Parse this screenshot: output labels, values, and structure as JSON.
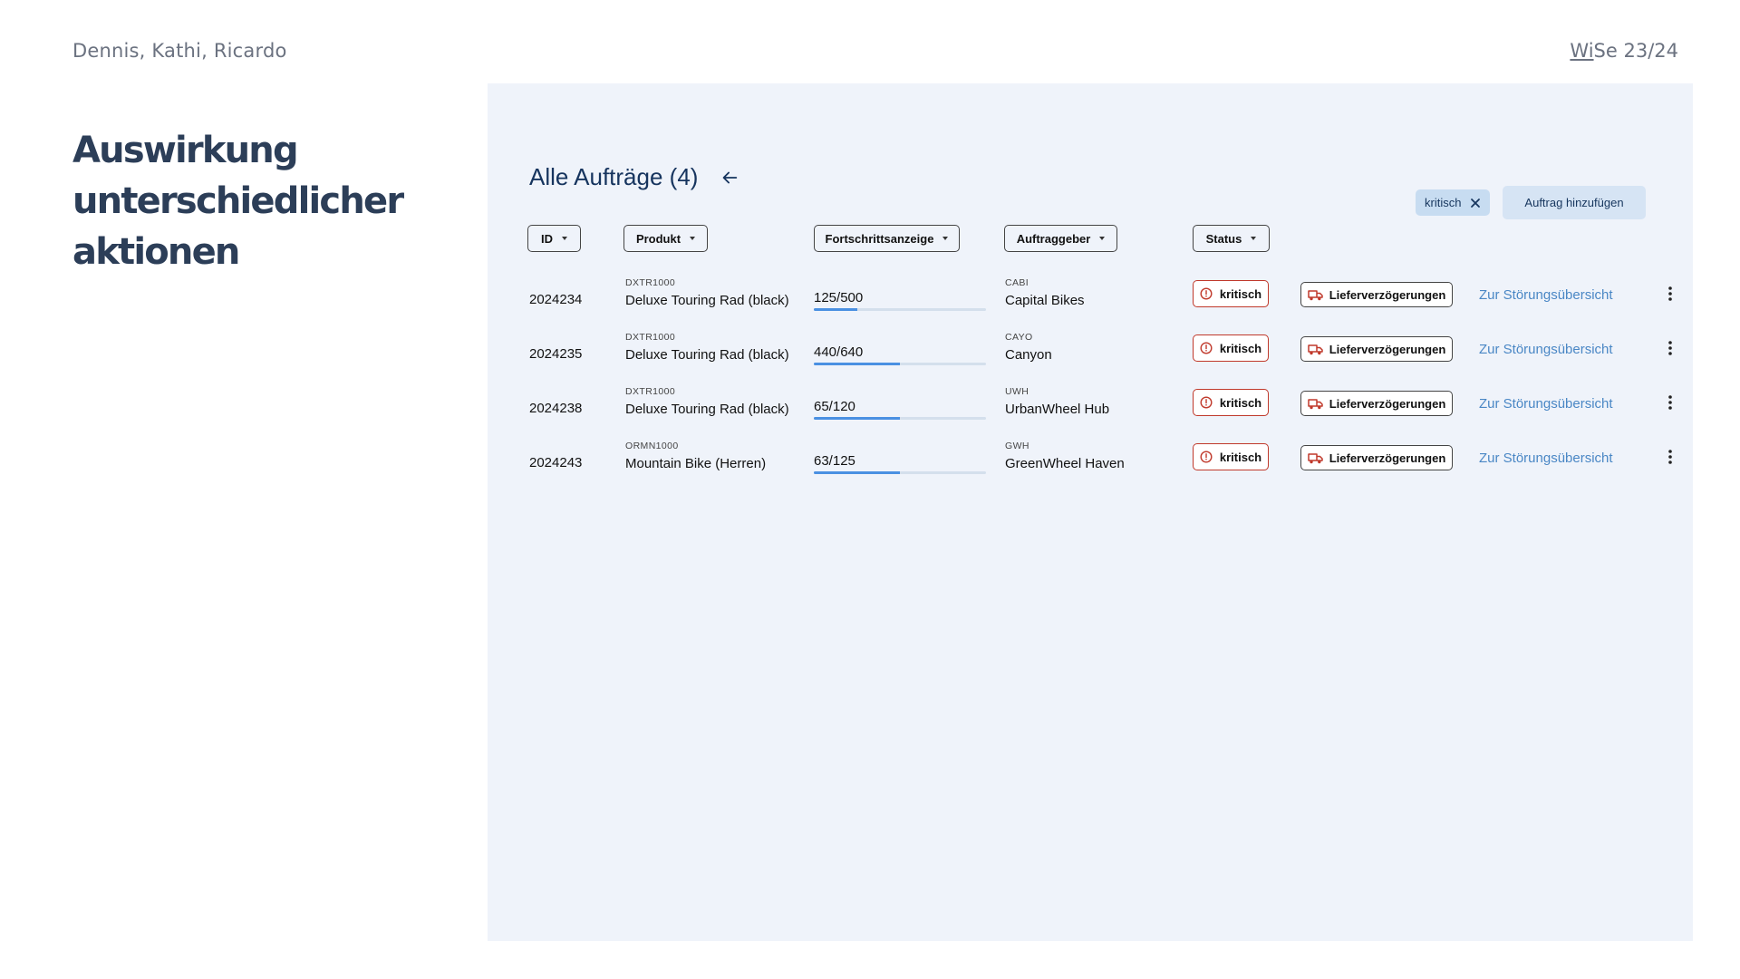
{
  "slide": {
    "authors": "Dennis, Kathi, Ricardo",
    "semester_prefix": "Wi",
    "semester_suffix": "Se 23/24",
    "title_lines": [
      "Auswirkung",
      "unterschiedlicher",
      "aktionen"
    ]
  },
  "panel": {
    "title": "Alle Aufträge (4)",
    "back_icon": "arrow-left-icon",
    "chip": {
      "label": "kritisch",
      "icon": "close-icon"
    },
    "add_button_label": "Auftrag hinzufügen"
  },
  "filters": {
    "id": "ID",
    "produkt": "Produkt",
    "fortschritt": "Fortschrittsanzeige",
    "auftraggeber": "Auftraggeber",
    "status": "Status"
  },
  "orders": [
    {
      "id": "2024234",
      "product_code": "DXTR1000",
      "product_name": "Deluxe Touring Rad (black)",
      "progress_text": "125/500",
      "progress": 0.25,
      "client_code": "CABI",
      "client_name": "Capital Bikes",
      "status": "kritisch",
      "issue": "Lieferverzögerungen",
      "link": "Zur Störungsübersicht"
    },
    {
      "id": "2024235",
      "product_code": "DXTR1000",
      "product_name": "Deluxe Touring Rad (black)",
      "progress_text": "440/640",
      "progress": 0.5,
      "client_code": "CAYO",
      "client_name": "Canyon",
      "status": "kritisch",
      "issue": "Lieferverzögerungen",
      "link": "Zur Störungsübersicht"
    },
    {
      "id": "2024238",
      "product_code": "DXTR1000",
      "product_name": "Deluxe Touring Rad (black)",
      "progress_text": "65/120",
      "progress": 0.5,
      "client_code": "UWH",
      "client_name": "UrbanWheel Hub",
      "status": "kritisch",
      "issue": "Lieferverzögerungen",
      "link": "Zur Störungsübersicht"
    },
    {
      "id": "2024243",
      "product_code": "ORMN1000",
      "product_name": "Mountain Bike (Herren)",
      "progress_text": "63/125",
      "progress": 0.5,
      "client_code": "GWH",
      "client_name": "GreenWheel Haven",
      "status": "kritisch",
      "issue": "Lieferverzögerungen",
      "link": "Zur Störungsübersicht"
    }
  ],
  "icons": {
    "status": "alert-circle-icon",
    "issue": "truck-icon",
    "more": "more-vertical-icon",
    "dropdown": "caret-down-icon"
  },
  "colors": {
    "panel_bg": "#eff3fa",
    "title": "#2c3e58",
    "accent": "#4a90e2",
    "critical": "#c0392b",
    "link": "#4a87c5",
    "chip_bg": "#c7dcf1"
  }
}
